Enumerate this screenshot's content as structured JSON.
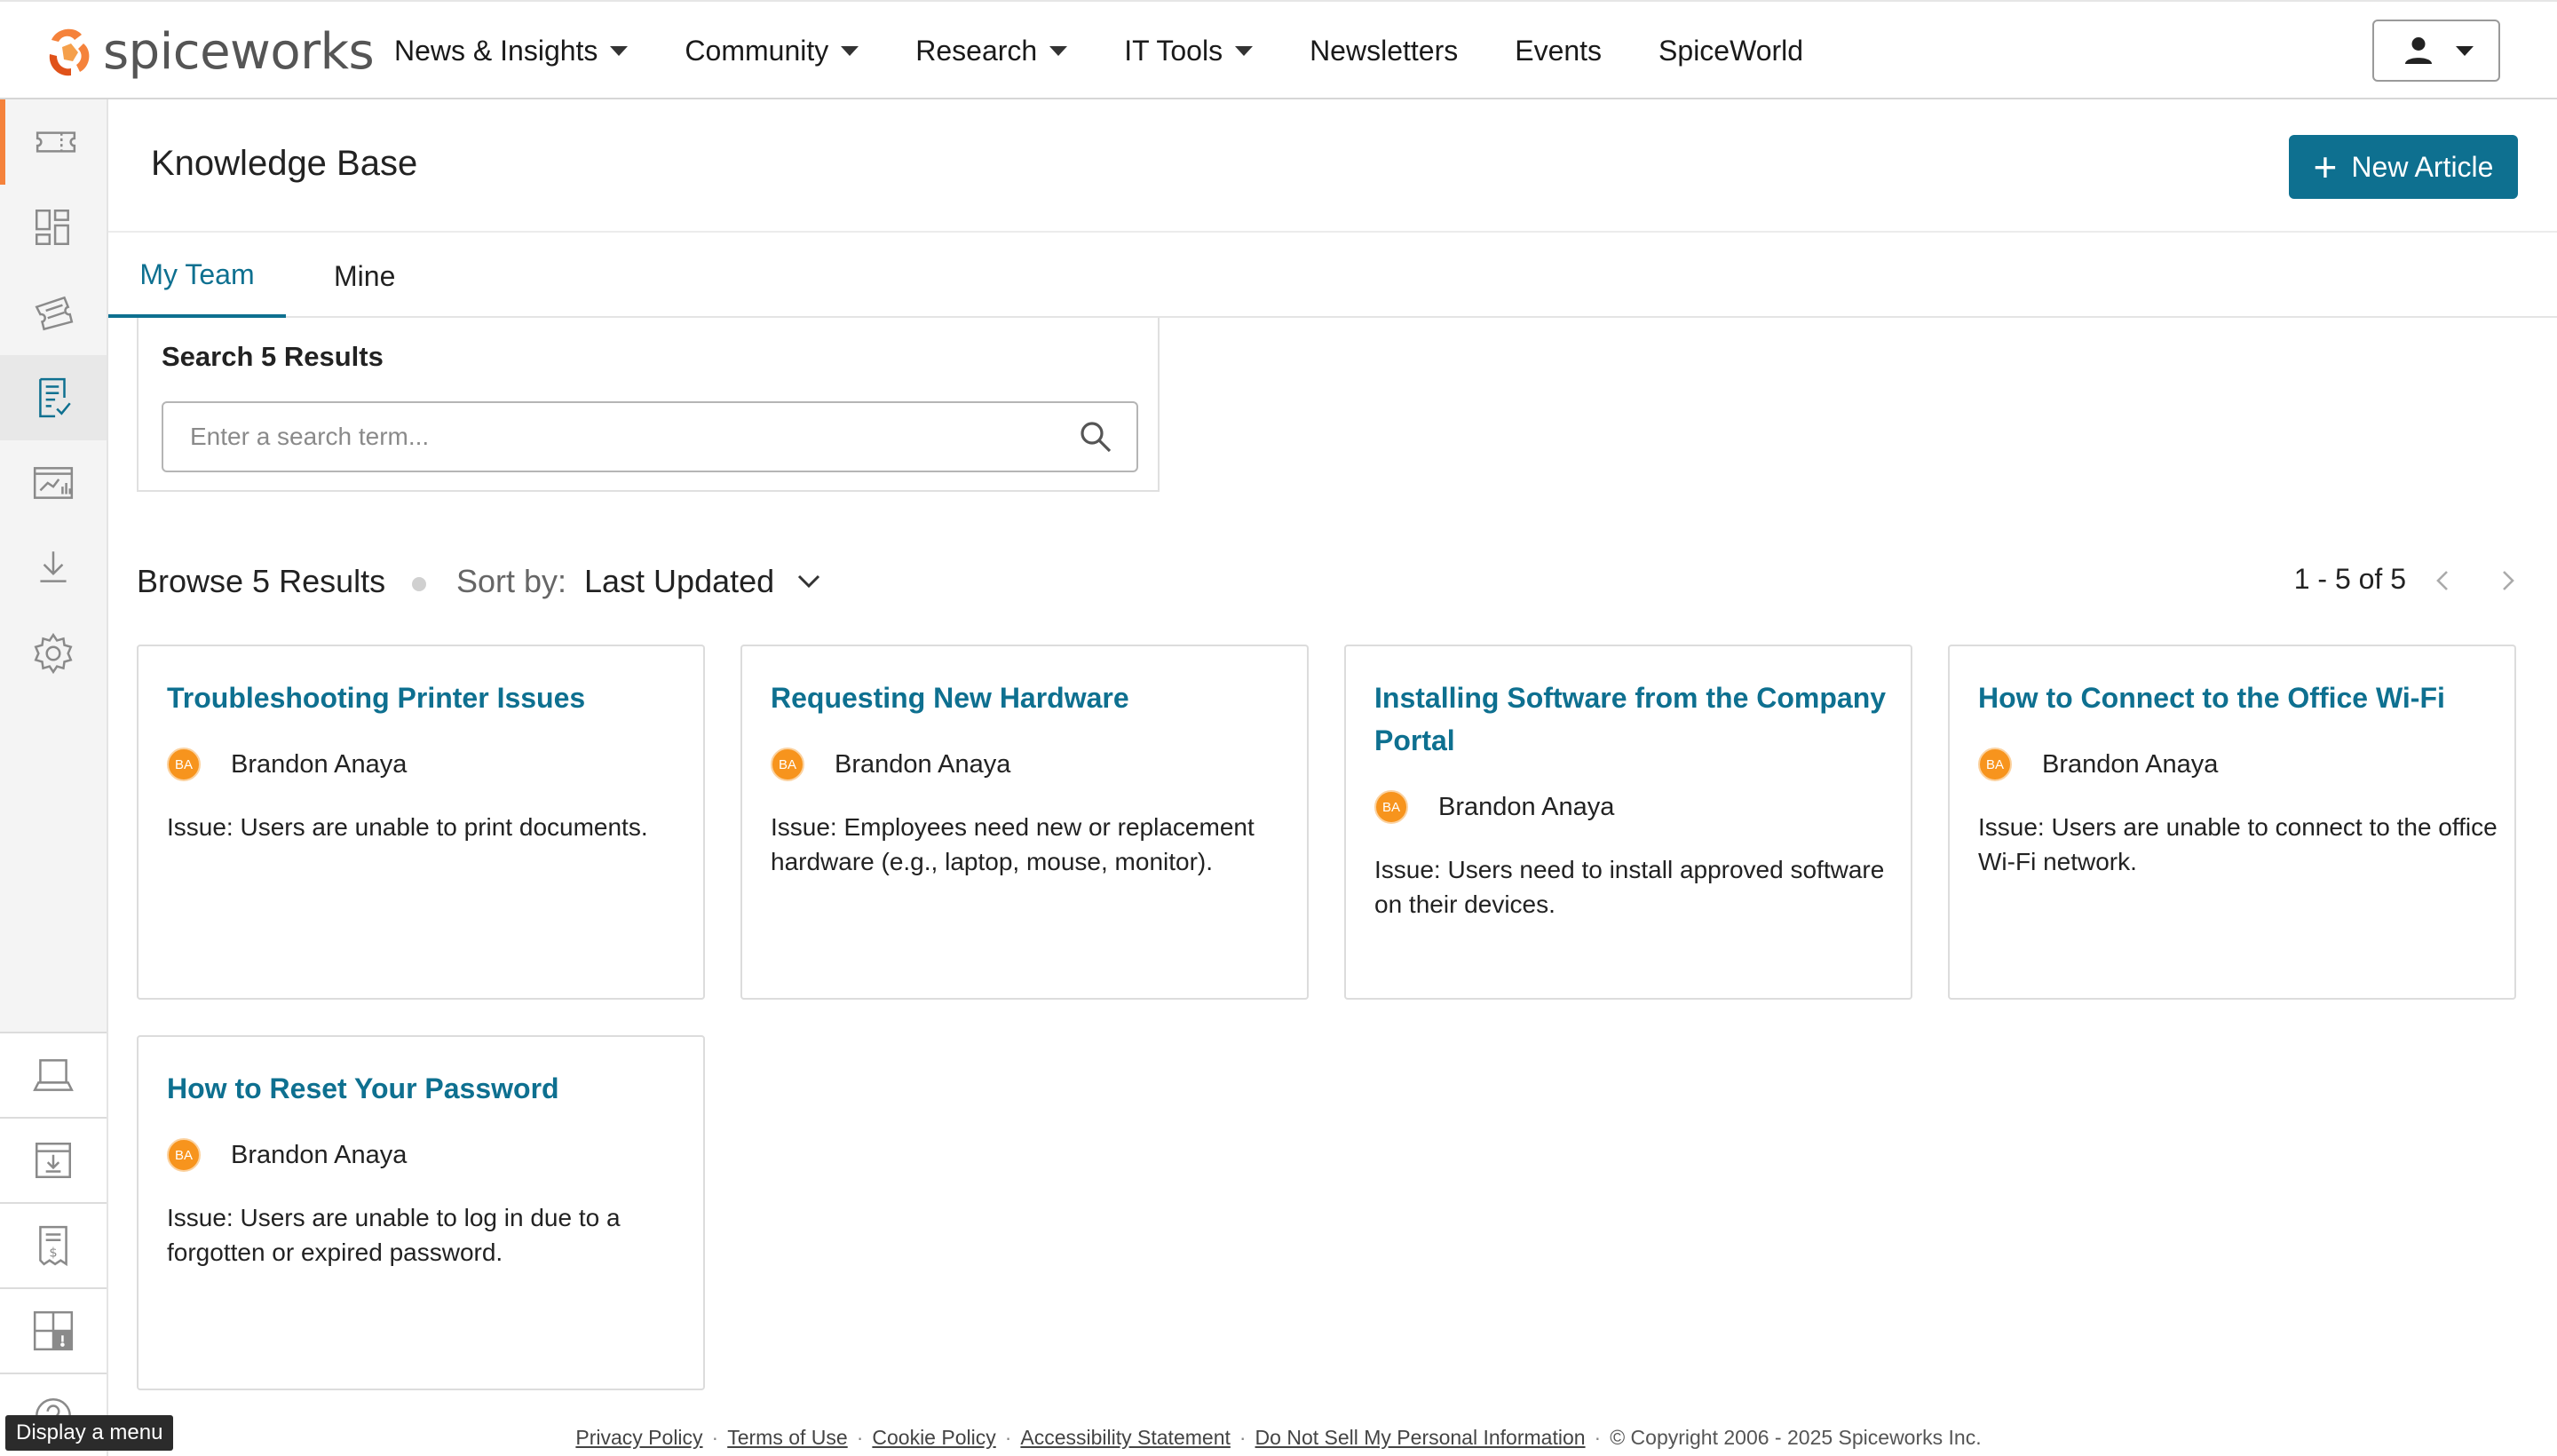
{
  "brand": {
    "name": "spiceworks",
    "icon": "spiceworks-logo"
  },
  "nav": {
    "items": [
      {
        "label": "News & Insights",
        "has_dropdown": true
      },
      {
        "label": "Community",
        "has_dropdown": true
      },
      {
        "label": "Research",
        "has_dropdown": true
      },
      {
        "label": "IT Tools",
        "has_dropdown": true
      },
      {
        "label": "Newsletters",
        "has_dropdown": false
      },
      {
        "label": "Events",
        "has_dropdown": false
      },
      {
        "label": "SpiceWorld",
        "has_dropdown": false
      }
    ],
    "user_icon": "user-icon"
  },
  "sidebar": {
    "top_items": [
      {
        "icon": "ticket-icon"
      },
      {
        "icon": "dashboard-icon"
      },
      {
        "icon": "tickets-stack-icon"
      },
      {
        "icon": "knowledge-base-icon"
      },
      {
        "icon": "reports-icon"
      },
      {
        "icon": "download-icon"
      },
      {
        "icon": "settings-icon"
      }
    ],
    "bottom_items": [
      {
        "icon": "laptop-icon"
      },
      {
        "icon": "inbox-download-icon"
      },
      {
        "icon": "invoice-icon"
      },
      {
        "icon": "alert-panel-icon"
      },
      {
        "icon": "help-icon"
      }
    ]
  },
  "page": {
    "title": "Knowledge Base",
    "new_article_label": "New Article",
    "accent_color": "#0e7090"
  },
  "tabs": [
    {
      "label": "My Team",
      "active": true
    },
    {
      "label": "Mine",
      "active": false
    }
  ],
  "search": {
    "heading": "Search 5 Results",
    "placeholder": "Enter a search term...",
    "value": ""
  },
  "browse": {
    "count_label": "Browse 5 Results",
    "sort_label": "Sort by:",
    "sort_value": "Last Updated",
    "pager_text": "1 - 5 of 5"
  },
  "articles": [
    {
      "title": "Troubleshooting Printer Issues",
      "author": "Brandon Anaya",
      "initials": "BA",
      "description": "Issue: Users are unable to print documents."
    },
    {
      "title": "Requesting New Hardware",
      "author": "Brandon Anaya",
      "initials": "BA",
      "description": "Issue: Employees need new or replacement hardware (e.g., laptop, mouse, monitor)."
    },
    {
      "title": "Installing Software from the Company Portal",
      "author": "Brandon Anaya",
      "initials": "BA",
      "description": "Issue: Users need to install approved software on their devices."
    },
    {
      "title": "How to Connect to the Office Wi-Fi",
      "author": "Brandon Anaya",
      "initials": "BA",
      "description": "Issue: Users are unable to connect to the office Wi-Fi network."
    },
    {
      "title": "How to Reset Your Password",
      "author": "Brandon Anaya",
      "initials": "BA",
      "description": "Issue: Users are unable to log in due to a forgotten or expired password."
    }
  ],
  "footer": {
    "links": [
      "Privacy Policy",
      "Terms of Use",
      "Cookie Policy",
      "Accessibility Statement",
      "Do Not Sell My Personal Information"
    ],
    "copyright": "© Copyright 2006 - 2025 Spiceworks Inc."
  },
  "tooltip": {
    "text": "Display a menu"
  }
}
